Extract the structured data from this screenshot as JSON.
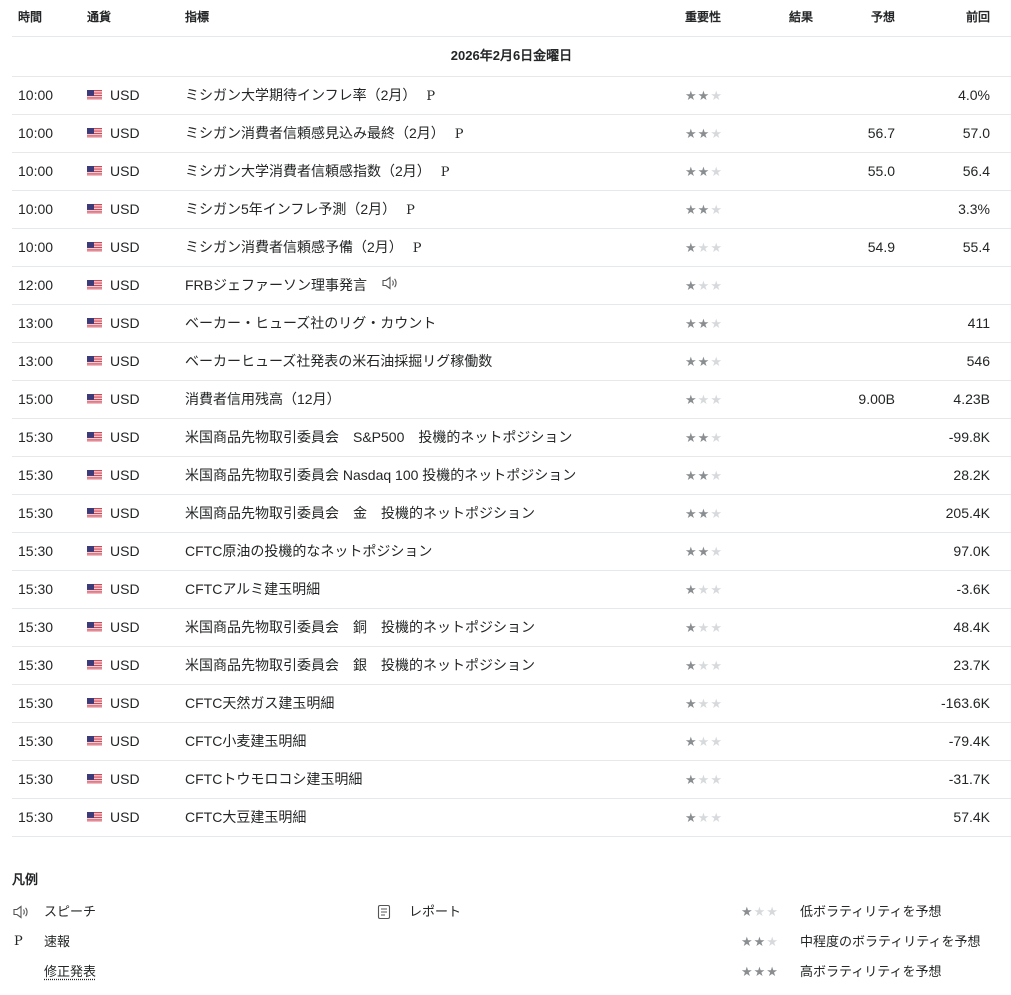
{
  "table": {
    "headers": {
      "time": "時間",
      "currency": "通貨",
      "indicator": "指標",
      "importance": "重要性",
      "actual": "結果",
      "forecast": "予想",
      "previous": "前回"
    },
    "date_label": "2026年2月6日金曜日",
    "rows": [
      {
        "time": "10:00",
        "currency": "USD",
        "name": "ミシガン大学期待インフレ率（2月）",
        "tag": "P",
        "speech": false,
        "importance": 2,
        "forecast": "",
        "previous": "4.0%"
      },
      {
        "time": "10:00",
        "currency": "USD",
        "name": "ミシガン消費者信頼感見込み最終（2月）",
        "tag": "P",
        "speech": false,
        "importance": 2,
        "forecast": "56.7",
        "previous": "57.0"
      },
      {
        "time": "10:00",
        "currency": "USD",
        "name": "ミシガン大学消費者信頼感指数（2月）",
        "tag": "P",
        "speech": false,
        "importance": 2,
        "forecast": "55.0",
        "previous": "56.4"
      },
      {
        "time": "10:00",
        "currency": "USD",
        "name": "ミシガン5年インフレ予測（2月）",
        "tag": "P",
        "speech": false,
        "importance": 2,
        "forecast": "",
        "previous": "3.3%"
      },
      {
        "time": "10:00",
        "currency": "USD",
        "name": "ミシガン消費者信頼感予備（2月）",
        "tag": "P",
        "speech": false,
        "importance": 1,
        "forecast": "54.9",
        "previous": "55.4"
      },
      {
        "time": "12:00",
        "currency": "USD",
        "name": "FRBジェファーソン理事発言",
        "tag": "",
        "speech": true,
        "importance": 1,
        "forecast": "",
        "previous": ""
      },
      {
        "time": "13:00",
        "currency": "USD",
        "name": "ベーカー・ヒューズ社のリグ・カウント",
        "tag": "",
        "speech": false,
        "importance": 2,
        "forecast": "",
        "previous": "411"
      },
      {
        "time": "13:00",
        "currency": "USD",
        "name": "ベーカーヒューズ社発表の米石油採掘リグ稼働数",
        "tag": "",
        "speech": false,
        "importance": 2,
        "forecast": "",
        "previous": "546"
      },
      {
        "time": "15:00",
        "currency": "USD",
        "name": "消費者信用残高（12月）",
        "tag": "",
        "speech": false,
        "importance": 1,
        "forecast": "9.00B",
        "previous": "4.23B"
      },
      {
        "time": "15:30",
        "currency": "USD",
        "name": "米国商品先物取引委員会　S&P500　投機的ネットポジション",
        "tag": "",
        "speech": false,
        "importance": 2,
        "forecast": "",
        "previous": "-99.8K"
      },
      {
        "time": "15:30",
        "currency": "USD",
        "name": "米国商品先物取引委員会 Nasdaq 100 投機的ネットポジション",
        "tag": "",
        "speech": false,
        "importance": 2,
        "forecast": "",
        "previous": "28.2K"
      },
      {
        "time": "15:30",
        "currency": "USD",
        "name": "米国商品先物取引委員会　金　投機的ネットポジション",
        "tag": "",
        "speech": false,
        "importance": 2,
        "forecast": "",
        "previous": "205.4K"
      },
      {
        "time": "15:30",
        "currency": "USD",
        "name": "CFTC原油の投機的なネットポジション",
        "tag": "",
        "speech": false,
        "importance": 2,
        "forecast": "",
        "previous": "97.0K"
      },
      {
        "time": "15:30",
        "currency": "USD",
        "name": "CFTCアルミ建玉明細",
        "tag": "",
        "speech": false,
        "importance": 1,
        "forecast": "",
        "previous": "-3.6K"
      },
      {
        "time": "15:30",
        "currency": "USD",
        "name": "米国商品先物取引委員会　銅　投機的ネットポジション",
        "tag": "",
        "speech": false,
        "importance": 1,
        "forecast": "",
        "previous": "48.4K"
      },
      {
        "time": "15:30",
        "currency": "USD",
        "name": "米国商品先物取引委員会　銀　投機的ネットポジション",
        "tag": "",
        "speech": false,
        "importance": 1,
        "forecast": "",
        "previous": "23.7K"
      },
      {
        "time": "15:30",
        "currency": "USD",
        "name": "CFTC天然ガス建玉明細",
        "tag": "",
        "speech": false,
        "importance": 1,
        "forecast": "",
        "previous": "-163.6K"
      },
      {
        "time": "15:30",
        "currency": "USD",
        "name": "CFTC小麦建玉明細",
        "tag": "",
        "speech": false,
        "importance": 1,
        "forecast": "",
        "previous": "-79.4K"
      },
      {
        "time": "15:30",
        "currency": "USD",
        "name": "CFTCトウモロコシ建玉明細",
        "tag": "",
        "speech": false,
        "importance": 1,
        "forecast": "",
        "previous": "-31.7K"
      },
      {
        "time": "15:30",
        "currency": "USD",
        "name": "CFTC大豆建玉明細",
        "tag": "",
        "speech": false,
        "importance": 1,
        "forecast": "",
        "previous": "57.4K"
      }
    ]
  },
  "legend": {
    "title": "凡例",
    "speech": "スピーチ",
    "preliminary_symbol": "P",
    "preliminary": "速報",
    "revised": "修正発表",
    "report": "レポート",
    "low": "低ボラティリティを予想",
    "medium": "中程度のボラティリティを予想",
    "high": "高ボラティリティを予想"
  },
  "colors": {
    "star_on": "#8a8e91",
    "star_off": "#d7dadc",
    "border": "#e6e9eb",
    "text": "#232526"
  },
  "icons": {
    "flag": "us-flag-icon",
    "speech": "speaker-icon",
    "report": "document-icon",
    "star": "star-icon"
  }
}
